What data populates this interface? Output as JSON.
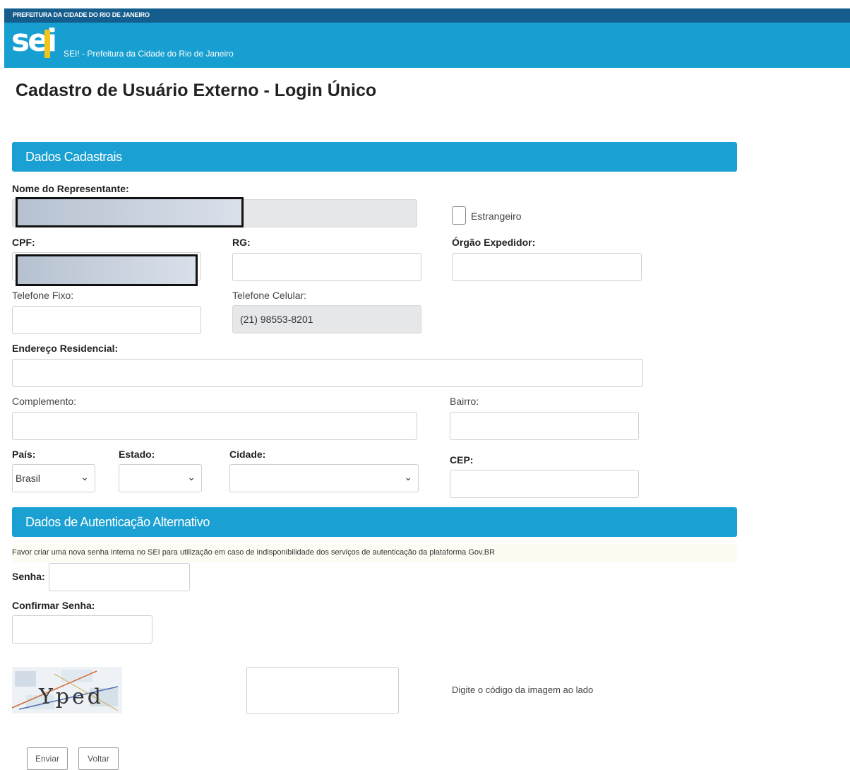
{
  "header": {
    "org": "PREFEITURA DA CIDADE DO RIO DE JANEIRO",
    "logo": "sei",
    "app_title": "SEI! - Prefeitura da Cidade do Rio de Janeiro"
  },
  "page_title": "Cadastro de Usuário Externo - Login Único",
  "sections": {
    "registration": "Dados Cadastrais",
    "auth": "Dados de Autenticação Alternativo"
  },
  "form": {
    "nome_label": "Nome do Representante:",
    "estrangeiro_label": "Estrangeiro",
    "cpf_label": "CPF:",
    "rg_label": "RG:",
    "orgao_label": "Órgão Expedidor:",
    "telefone_fixo_label": "Telefone Fixo:",
    "telefone_celular_label": "Telefone Celular:",
    "telefone_celular_value": "(21) 98553-8201",
    "endereco_label": "Endereço Residencial:",
    "complemento_label": "Complemento:",
    "bairro_label": "Bairro:",
    "pais_label": "País:",
    "pais_value": "Brasil",
    "estado_label": "Estado:",
    "cidade_label": "Cidade:",
    "cep_label": "CEP:"
  },
  "auth": {
    "note": "Favor criar uma nova senha interna no SEI para utilização em caso de indisponibilidade dos serviços de autenticação da plataforma Gov.BR",
    "senha_label": "Senha:",
    "confirmar_label": "Confirmar Senha:",
    "captcha_text": "Yped",
    "captcha_hint": "Digite o código da imagem ao lado"
  },
  "buttons": {
    "enviar": "Enviar",
    "voltar": "Voltar"
  },
  "colors": {
    "top_bar": "#155d8c",
    "header": "#169fd0",
    "section_bar": "#1aa0d3",
    "logo_accent": "#f0c419"
  }
}
